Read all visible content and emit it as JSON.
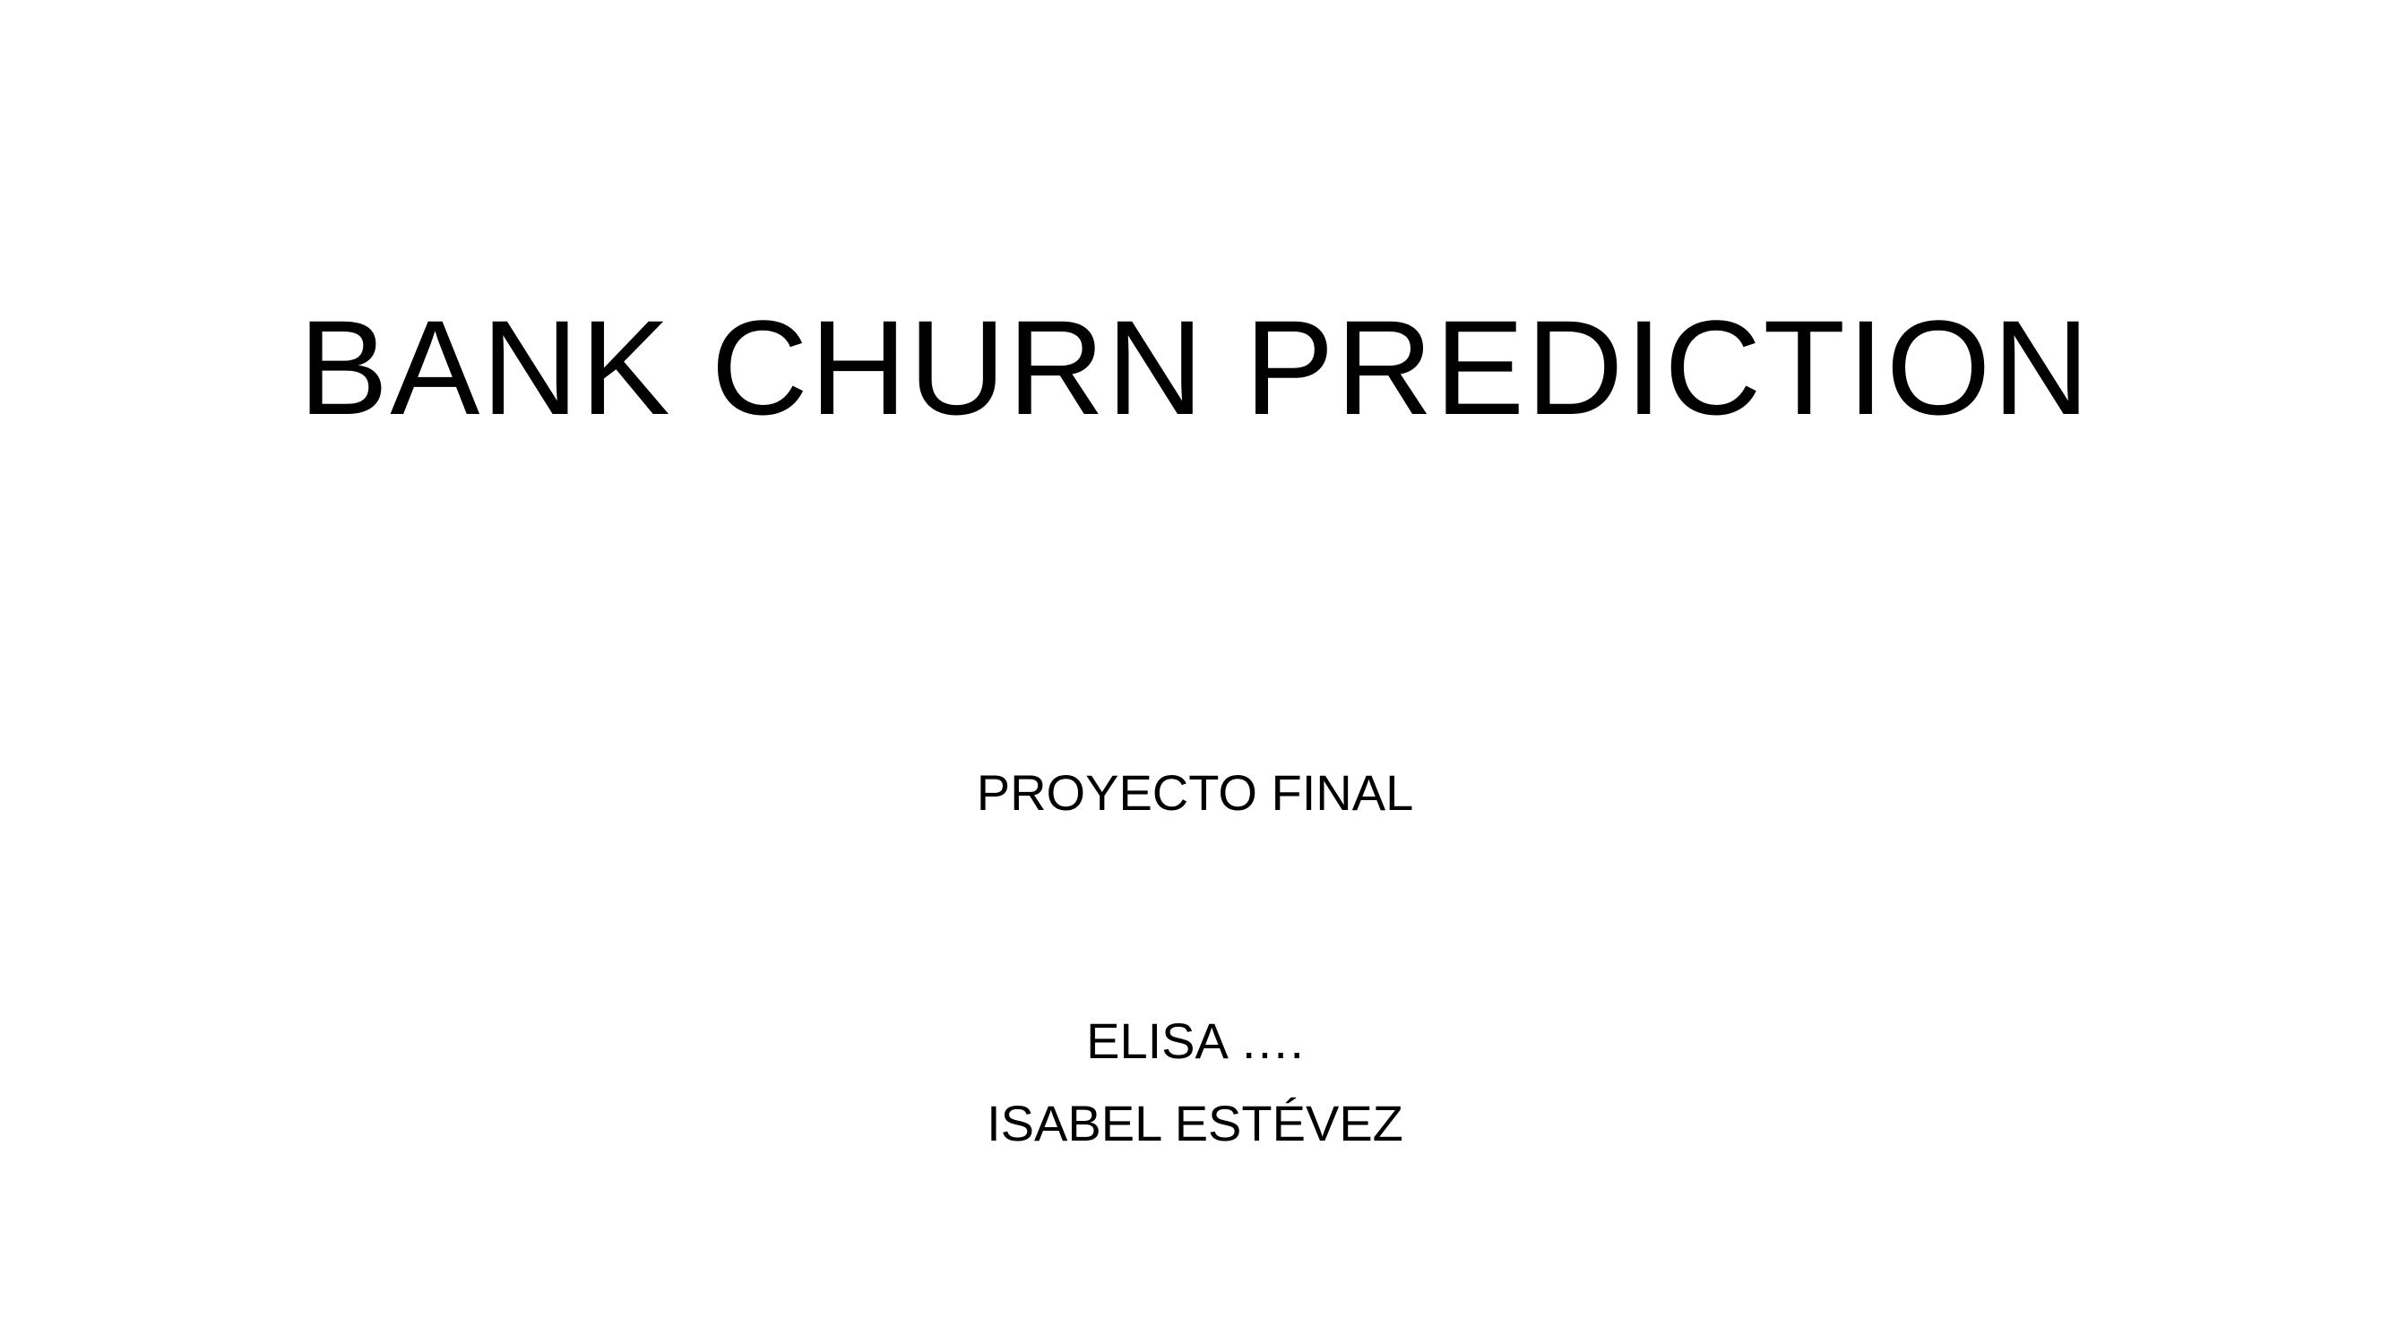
{
  "slide": {
    "title": "BANK CHURN PREDICTION",
    "subtitle": "PROYECTO FINAL",
    "authors": [
      "ELISA ….",
      "ISABEL ESTÉVEZ"
    ]
  },
  "colors": {
    "background": "#ffffff",
    "text": "#000000"
  }
}
